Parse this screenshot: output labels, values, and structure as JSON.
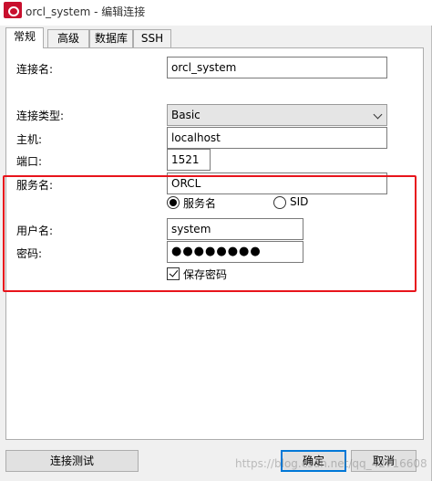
{
  "window": {
    "title": "orcl_system - 编辑连接"
  },
  "tabs": [
    {
      "label": "常规",
      "active": true
    },
    {
      "label": "高级",
      "active": false
    },
    {
      "label": "数据库",
      "active": false
    },
    {
      "label": "SSH",
      "active": false
    }
  ],
  "form": {
    "connection_name": {
      "label": "连接名:",
      "value": "orcl_system"
    },
    "connection_type": {
      "label": "连接类型:",
      "value": "Basic"
    },
    "host": {
      "label": "主机:",
      "value": "localhost"
    },
    "port": {
      "label": "端口:",
      "value": "1521"
    },
    "service_name": {
      "label": "服务名:",
      "value": "ORCL"
    },
    "service_mode": {
      "options": [
        "服务名",
        "SID"
      ],
      "selected": "服务名"
    },
    "username": {
      "label": "用户名:",
      "value": "system"
    },
    "password": {
      "label": "密码:",
      "value": "●●●●●●●●"
    },
    "save_password": {
      "label": "保存密码",
      "checked": true
    }
  },
  "buttons": {
    "test": "连接测试",
    "ok": "确定",
    "cancel": "取消"
  },
  "watermark": "https://blog.csdn.net/qq_42716608",
  "colors": {
    "highlight": "#e8141c",
    "brand": "#c8102e",
    "accent": "#0078d7"
  }
}
